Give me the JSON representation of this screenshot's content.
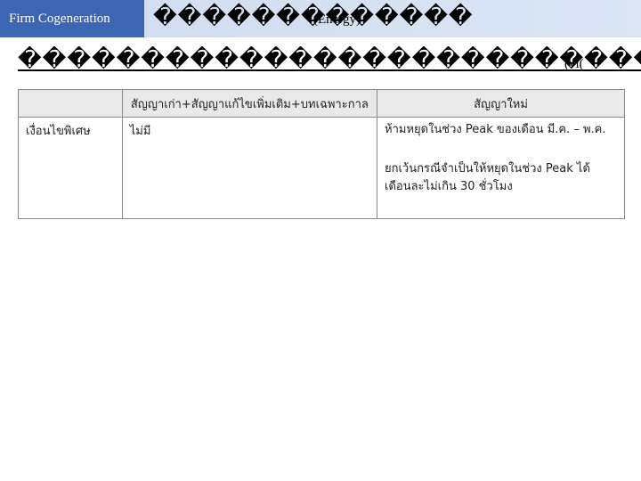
{
  "header": {
    "tab_label": "Firm Cogeneration",
    "title": "�������������",
    "title_sub": "(Energy)"
  },
  "heading": {
    "text": "�����������������������������",
    "sub": "(vi("
  },
  "table": {
    "headers": [
      "",
      "สัญญาเก่า+สัญญาแก้ไขเพิ่มเติม+บทเฉพาะกาล",
      "สัญญาใหม่"
    ],
    "rows": [
      {
        "label": "เงื่อนไขพิเศษ",
        "old": "ไม่มี",
        "new_p1": "ห้ามหยุดในช่วง Peak ของเดือน มี.ค. – พ.ค.",
        "new_p2": "ยกเว้นกรณีจำเป็นให้หยุดในช่วง Peak ได้ เดือนละไม่เกิน 30 ชั่วโมง"
      }
    ]
  }
}
